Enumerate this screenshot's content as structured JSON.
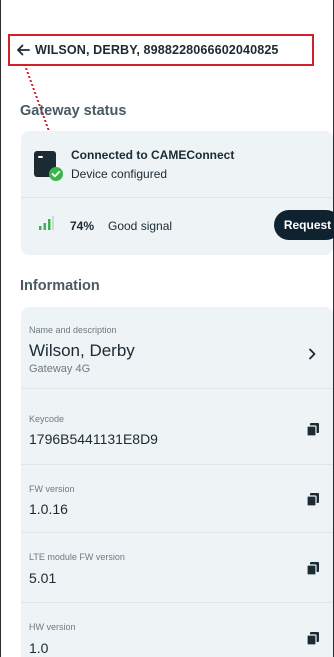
{
  "header": {
    "title": "WILSON, DERBY, 8988228066602040825"
  },
  "gateway_status": {
    "section_title": "Gateway status",
    "connection_title": "Connected to CAMEConnect",
    "connection_sub": "Device configured",
    "signal_percent": "74%",
    "signal_label": "Good signal",
    "request_label": "Request"
  },
  "information": {
    "section_title": "Information",
    "name": {
      "label": "Name and description",
      "value": "Wilson, Derby",
      "sub": "Gateway 4G"
    },
    "keycode": {
      "label": "Keycode",
      "value": "1796B5441131E8D9"
    },
    "fw_version": {
      "label": "FW version",
      "value": "1.0.16"
    },
    "lte_fw_version": {
      "label": "LTE module FW version",
      "value": "5.01"
    },
    "hw_version": {
      "label": "HW version",
      "value": "1.0"
    }
  },
  "colors": {
    "accent_outline": "#d0212a",
    "button_bg": "#0f2230",
    "card_bg": "#eef3f5",
    "signal_green": "#3bb54a"
  },
  "icons": [
    "back-arrow-icon",
    "gateway-icon",
    "check-badge-icon",
    "signal-icon",
    "chevron-right-icon",
    "copy-icon"
  ]
}
